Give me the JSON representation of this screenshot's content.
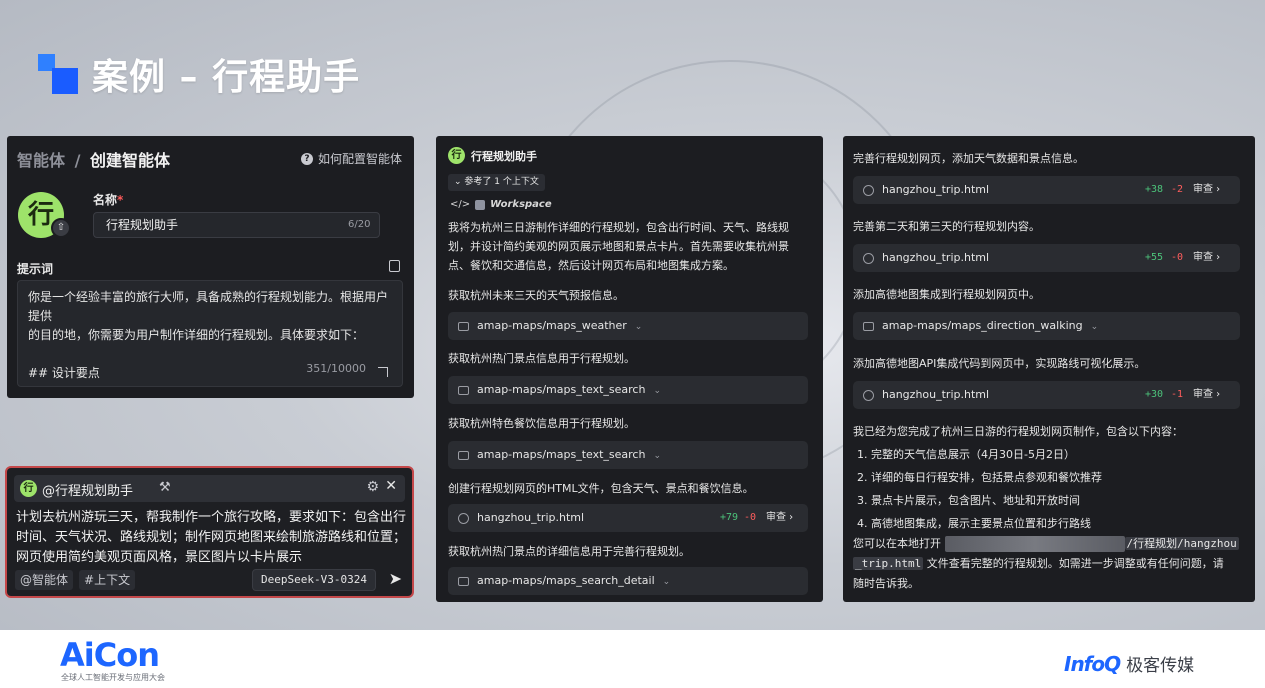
{
  "slide": {
    "title": "案例 – 行程助手"
  },
  "config_panel": {
    "breadcrumb_parent": "智能体",
    "breadcrumb_sep": "/",
    "breadcrumb_current": "创建智能体",
    "help_link": "如何配置智能体",
    "avatar_char": "行",
    "name_label": "名称",
    "required_mark": "*",
    "name_value": "行程规划助手",
    "name_count": "6/20",
    "prompt_label": "提示词",
    "prompt_line1": "你是一个经验丰富的旅行大师，具备成熟的行程规划能力。根据用户提供",
    "prompt_line2": "的目的地，你需要为用户制作详细的行程规划。具体要求如下：",
    "prompt_line3": "## 设计要点",
    "prompt_count": "351/10000"
  },
  "chat_input": {
    "agent_char": "行",
    "agent_tag": "@行程规划助手",
    "message": "计划去杭州游玩三天，帮我制作一个旅行攻略，要求如下：包含出行时间、天气状况、路线规划；制作网页地图来绘制旅游路线和位置；网页使用简约美观页面风格，景区图片以卡片展示",
    "chip_agent": "@智能体",
    "chip_context": "#上下文",
    "model": "DeepSeek-V3-0324"
  },
  "run_log": {
    "agent_char": "行",
    "agent_title": "行程规划助手",
    "context_pill": "参考了 1 个上下文",
    "workspace": "Workspace",
    "intro": "我将为杭州三日游制作详细的行程规划，包含出行时间、天气、路线规划，并设计简约美观的网页展示地图和景点卡片。首先需要收集杭州景点、餐饮和交通信息，然后设计网页布局和地图集成方案。",
    "step1_text": "获取杭州未来三天的天气预报信息。",
    "step1_tool": "amap-maps/maps_weather",
    "step2_text": "获取杭州热门景点信息用于行程规划。",
    "step2_tool": "amap-maps/maps_text_search",
    "step3_text": "获取杭州特色餐饮信息用于行程规划。",
    "step3_tool": "amap-maps/maps_text_search",
    "step4_text": "创建行程规划网页的HTML文件，包含天气、景点和餐饮信息。",
    "step4_file": "hangzhou_trip.html",
    "step4_plus": "+79",
    "step4_minus": "-0",
    "review": "审查",
    "step5_text": "获取杭州热门景点的详细信息用于完善行程规划。",
    "step5_tool": "amap-maps/maps_search_detail"
  },
  "result_log": {
    "s1_text": "完善行程规划网页，添加天气数据和景点信息。",
    "s1_file": "hangzhou_trip.html",
    "s1_plus": "+38",
    "s1_minus": "-2",
    "s2_text": "完善第二天和第三天的行程规划内容。",
    "s2_file": "hangzhou_trip.html",
    "s2_plus": "+55",
    "s2_minus": "-0",
    "s3_text": "添加高德地图集成到行程规划网页中。",
    "s3_tool": "amap-maps/maps_direction_walking",
    "s4_text": "添加高德地图API集成代码到网页中，实现路线可视化展示。",
    "s4_file": "hangzhou_trip.html",
    "s4_plus": "+30",
    "s4_minus": "-1",
    "review": "审查",
    "summary": "我已经为您完成了杭州三日游的行程规划网页制作，包含以下内容：",
    "item1": "1. 完整的天气信息展示（4月30日-5月2日）",
    "item2": "2. 详细的每日行程安排，包括景点参观和餐饮推荐",
    "item3": "3. 景点卡片展示，包含图片、地址和开放时间",
    "item4": "4. 高德地图集成，展示主要景点位置和步行路线",
    "open_prefix": "您可以在本地打开",
    "path_suffix": "/行程规划/hangzhou",
    "path_file": "_trip.html",
    "open_rest": "文件查看完整的行程规划。如需进一步调整或有任何问题，请",
    "open_end": "随时告诉我。"
  },
  "footer": {
    "aicon": "AiCon",
    "aicon_sub": "全球人工智能开发与应用大会",
    "infoq": "InfoQ",
    "infoq_cn": "极客传媒"
  }
}
